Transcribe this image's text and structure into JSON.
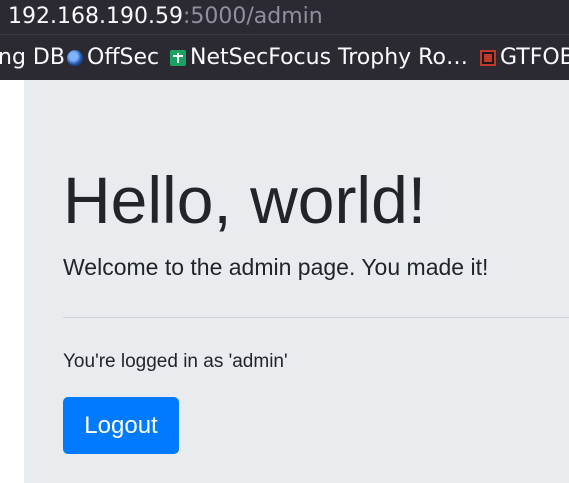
{
  "browser": {
    "url_host": "192.168.190.59",
    "url_path": ":5000/admin",
    "bookmarks": [
      {
        "label": "ng DB",
        "icon": "none"
      },
      {
        "label": "OffSec",
        "icon": "offsec-icon"
      },
      {
        "label": "NetSecFocus Trophy Ro…",
        "icon": "sheets-icon"
      },
      {
        "label": "GTFOB",
        "icon": "gtfobins-icon"
      }
    ]
  },
  "page": {
    "heading": "Hello, world!",
    "lead": "Welcome to the admin page. You made it!",
    "status": "You're logged in as 'admin'",
    "logout_label": "Logout"
  },
  "colors": {
    "jumbotron_bg": "#e9ecef",
    "button_primary": "#007bff",
    "toolbar_bg": "#2b2a33"
  }
}
